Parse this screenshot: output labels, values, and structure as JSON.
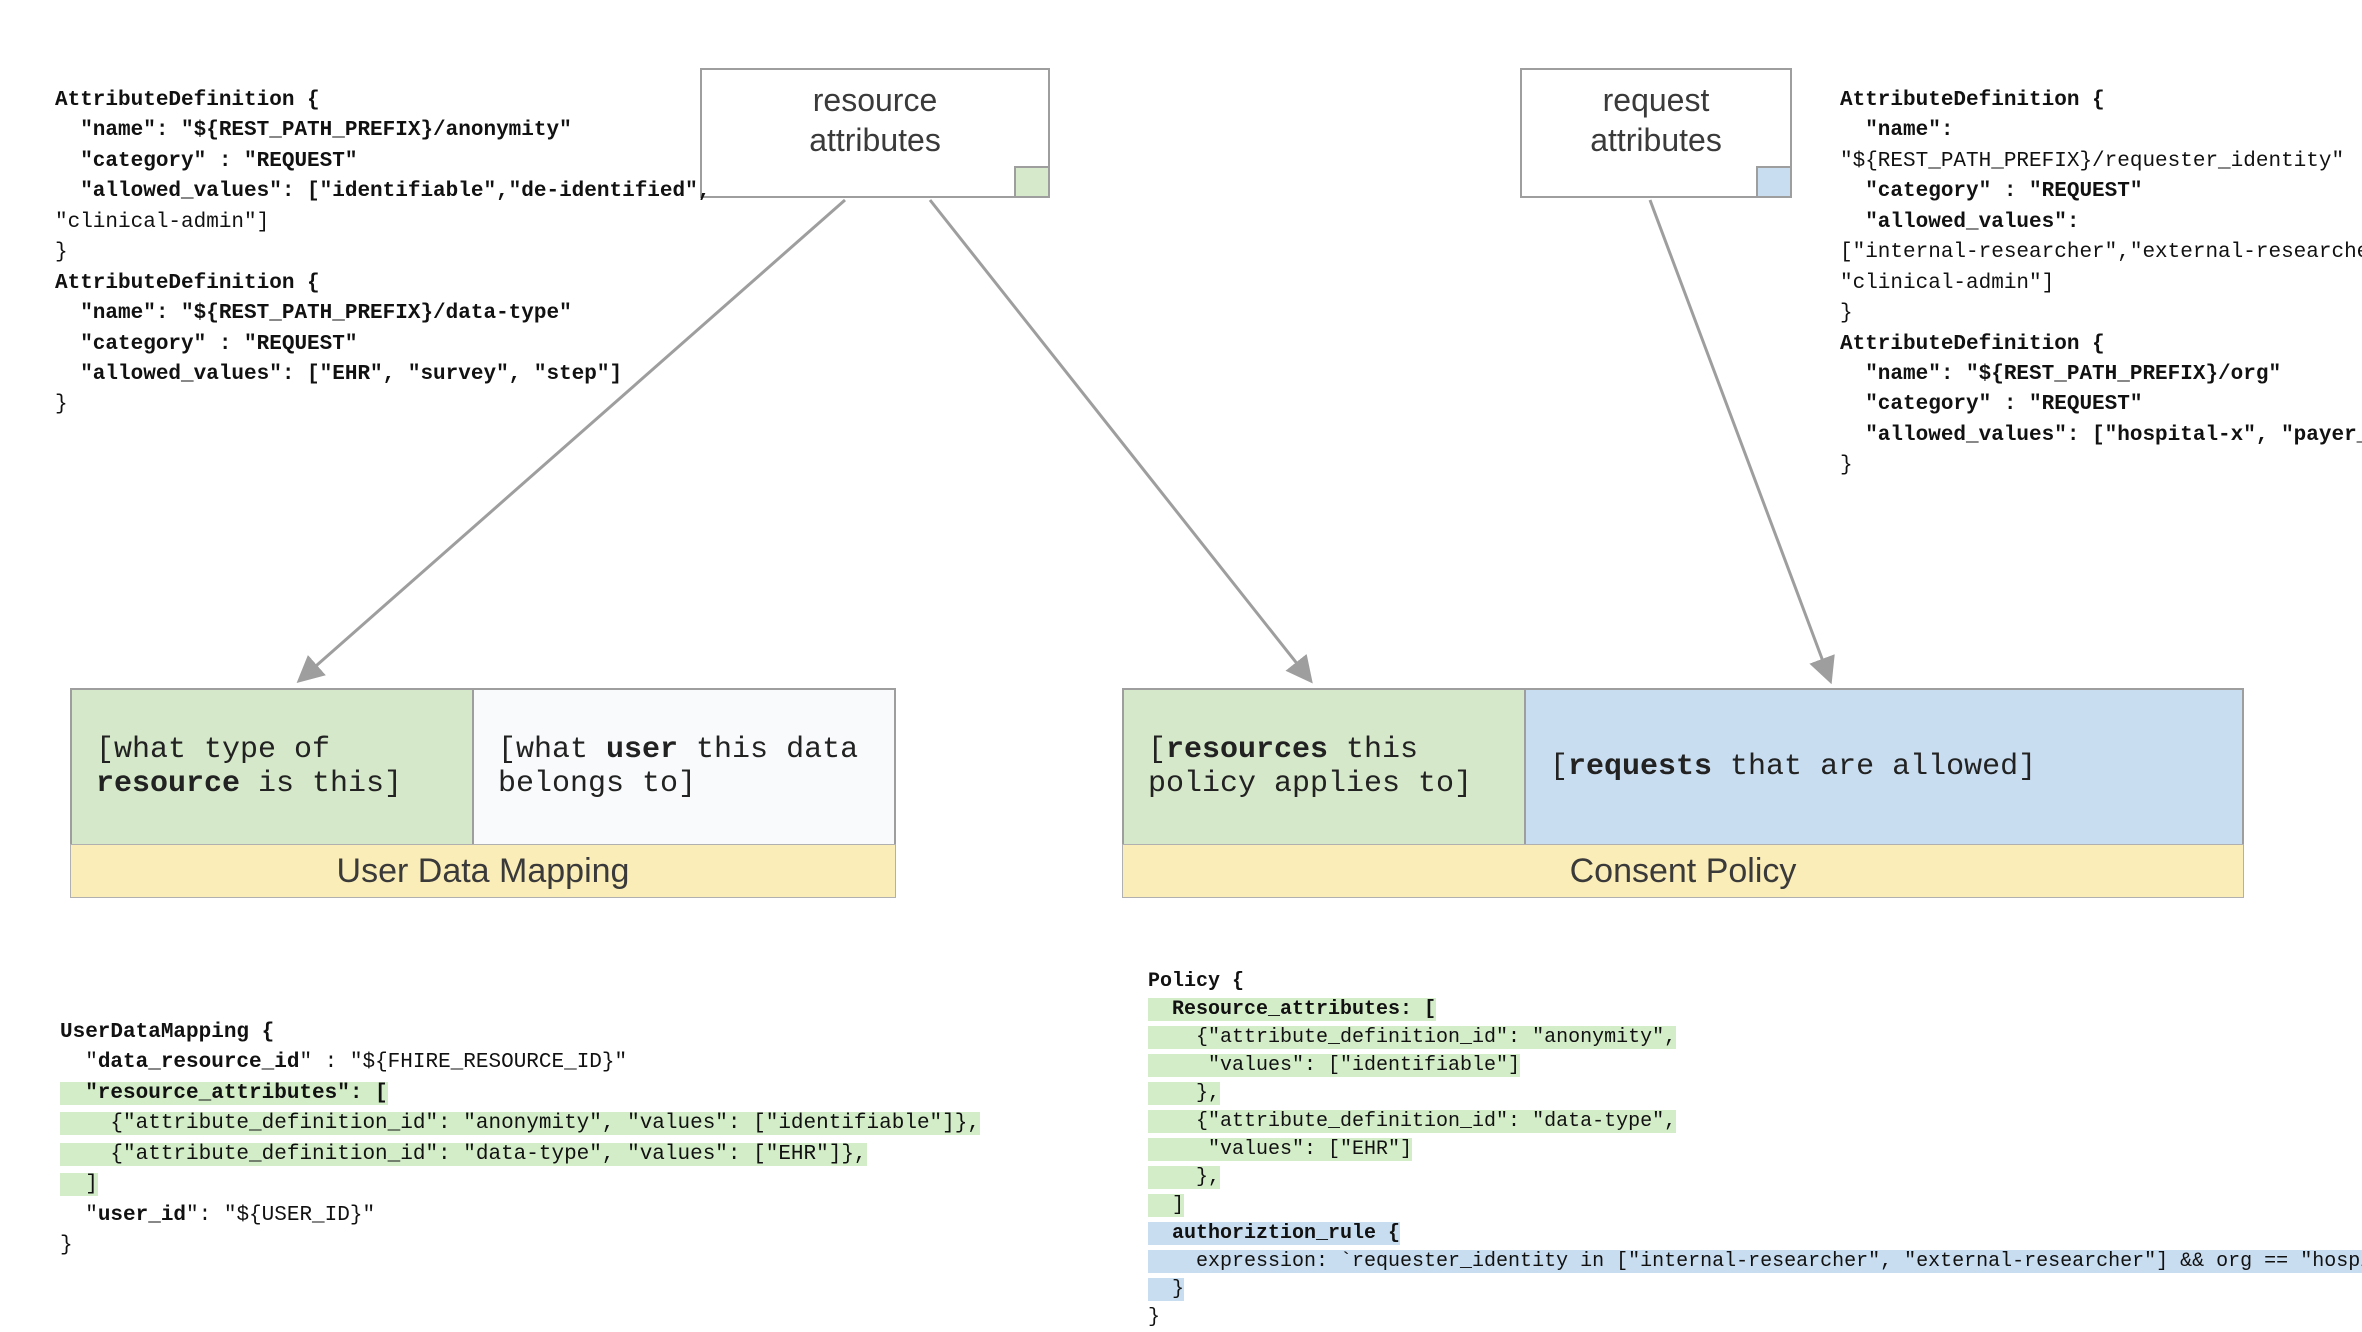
{
  "top_boxes": {
    "resource": {
      "line1": "resource",
      "line2": "attributes"
    },
    "request": {
      "line1": "request",
      "line2": "attributes"
    }
  },
  "left_attr_code": {
    "l1": "AttributeDefinition {",
    "l2": "  \"name\": \"${REST_PATH_PREFIX}/anonymity\"",
    "l3": "  \"category\" : \"REQUEST\"",
    "l4": "  \"allowed_values\": [\"identifiable\",\"de-identified\",",
    "l5": "\"clinical-admin\"]",
    "l6": "}",
    "l7": "AttributeDefinition {",
    "l8": "  \"name\": \"${REST_PATH_PREFIX}/data-type\"",
    "l9": "  \"category\" : \"REQUEST\"",
    "l10": "  \"allowed_values\": [\"EHR\", \"survey\", \"step\"]",
    "l11": "}"
  },
  "right_attr_code": {
    "l1": "AttributeDefinition {",
    "l2": "  \"name\":",
    "l3": "\"${REST_PATH_PREFIX}/requester_identity\"",
    "l4": "  \"category\" : \"REQUEST\"",
    "l5": "  \"allowed_values\":",
    "l6": "[\"internal-researcher\",\"external-researcher\",",
    "l7": "\"clinical-admin\"]",
    "l8": "}",
    "l9": "AttributeDefinition {",
    "l10": "  \"name\": \"${REST_PATH_PREFIX}/org\"",
    "l11": "  \"category\" : \"REQUEST\"",
    "l12": "  \"allowed_values\": [\"hospital-x\", \"payer_y\"]",
    "l13": "}"
  },
  "pills": {
    "resource_type_pre": "[what type of ",
    "resource_type_bold": "resource",
    "resource_type_post": " is this]",
    "user_belongs_pre": "[what ",
    "user_belongs_bold": "user",
    "user_belongs_post": " this data belongs to]",
    "policy_applies_pre": "[",
    "policy_applies_bold": "resources",
    "policy_applies_post": " this policy applies to]",
    "requests_allowed_pre": "[",
    "requests_allowed_bold": "requests",
    "requests_allowed_post": " that are allowed]"
  },
  "banners": {
    "user_data_mapping": "User Data Mapping",
    "consent_policy": "Consent Policy"
  },
  "udm_code": {
    "l1": "UserDataMapping {",
    "l2a": "  \"",
    "l2b": "data_resource_id",
    "l2c": "\" : \"${FHIRE_RESOURCE_ID}\"",
    "l3": "  \"resource_attributes\": [",
    "l4": "    {\"attribute_definition_id\": \"anonymity\", \"values\": [\"identifiable\"]},",
    "l5": "    {\"attribute_definition_id\": \"data-type\", \"values\": [\"EHR\"]},",
    "l6": "  ]",
    "l7a": "  \"",
    "l7b": "user_id",
    "l7c": "\": \"${USER_ID}\"",
    "l8": "}"
  },
  "policy_code": {
    "l1": "Policy {",
    "l2": "  Resource_attributes: [",
    "l3": "    {\"attribute_definition_id\": \"anonymity\",",
    "l4": "     \"values\": [\"identifiable\"]",
    "l5": "    },",
    "l6": "    {\"attribute_definition_id\": \"data-type\",",
    "l7": "     \"values\": [\"EHR\"]",
    "l8": "    },",
    "l9": "  ]",
    "l10": "  authoriztion_rule {",
    "l11": "    expression: `requester_identity in [\"internal-researcher\", \"external-researcher\"] && org == \"hospital-x\"`",
    "l12": "  }",
    "l13": "}"
  }
}
